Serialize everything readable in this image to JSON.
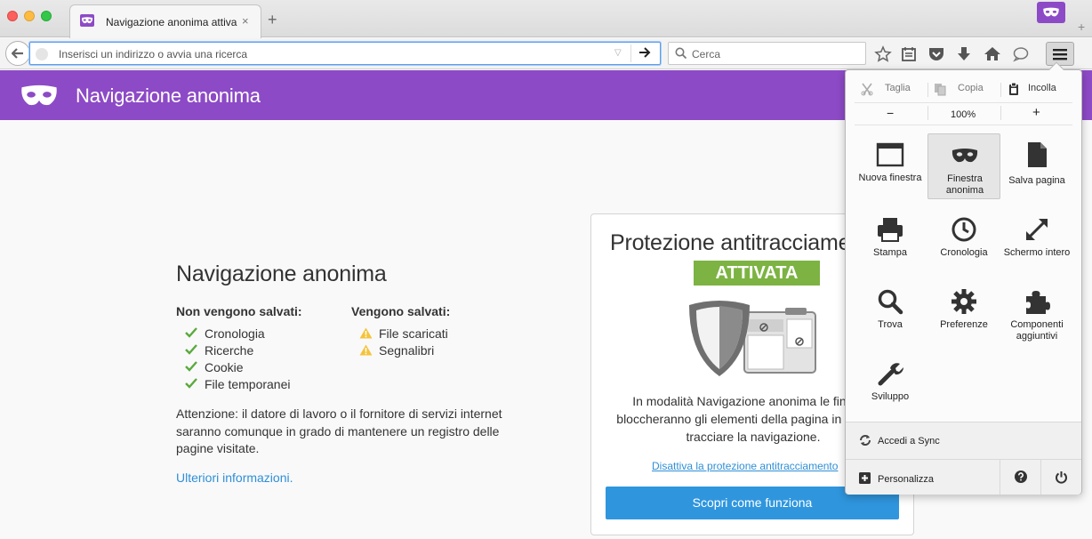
{
  "window": {
    "tab_title": "Navigazione anonima attiva",
    "tab_close": "×",
    "new_tab": "+",
    "edge_plus": "+"
  },
  "navbar": {
    "url_placeholder": "Inserisci un indirizzo o avvia una ricerca",
    "search_placeholder": "Cerca",
    "toolbar_icons": [
      "bookmark-star-icon",
      "reading-list-icon",
      "pocket-icon",
      "download-icon",
      "home-icon",
      "chat-icon",
      "hamburger-menu-icon"
    ]
  },
  "header": {
    "title": "Navigazione anonima"
  },
  "content": {
    "title": "Navigazione anonima",
    "not_saved": {
      "heading": "Non vengono salvati:",
      "items": [
        "Cronologia",
        "Ricerche",
        "Cookie",
        "File temporanei"
      ]
    },
    "saved": {
      "heading": "Vengono salvati:",
      "items": [
        "File scaricati",
        "Segnalibri"
      ]
    },
    "warning": "Attenzione: il datore di lavoro o il fornitore di servizi internet saranno comunque in grado di mantenere un registro delle pagine visitate.",
    "more_info": "Ulteriori informazioni."
  },
  "tracking_protection": {
    "title": "Protezione antitracciamento",
    "status_badge": "ATTIVATA",
    "description_lines": [
      "In modalità Navigazione anonima le finestre",
      "bloccheranno gli elementi della pagina in grado di",
      "tracciare la navigazione."
    ],
    "disable_link": "Disattiva la protezione antitracciamento",
    "learn_button": "Scopri come funziona"
  },
  "menu": {
    "edit": {
      "cut": "Taglia",
      "copy": "Copia",
      "paste": "Incolla"
    },
    "zoom": {
      "minus": "−",
      "value": "100%",
      "plus": "+"
    },
    "tiles": [
      {
        "label": "Nuova finestra",
        "icon": "new-window-icon"
      },
      {
        "label": "Finestra anonima",
        "icon": "private-mask-icon"
      },
      {
        "label": "Salva pagina",
        "icon": "save-page-icon"
      },
      {
        "label": "Stampa",
        "icon": "printer-icon"
      },
      {
        "label": "Cronologia",
        "icon": "history-clock-icon"
      },
      {
        "label": "Schermo intero",
        "icon": "fullscreen-icon"
      },
      {
        "label": "Trova",
        "icon": "find-magnifier-icon"
      },
      {
        "label": "Preferenze",
        "icon": "preferences-gear-icon"
      },
      {
        "label": "Componenti aggiuntivi",
        "icon": "addons-puzzle-icon"
      },
      {
        "label": "Sviluppo",
        "icon": "developer-wrench-icon"
      }
    ],
    "sync_label": "Accedi a Sync",
    "customize_label": "Personalizza"
  },
  "colors": {
    "private_purple": "#8d4ac6",
    "badge_green": "#7cb342",
    "link_blue": "#2f8fd6",
    "button_blue": "#2f96de",
    "check_green": "#5aaa3c",
    "warning_yellow": "#f5c33b"
  }
}
